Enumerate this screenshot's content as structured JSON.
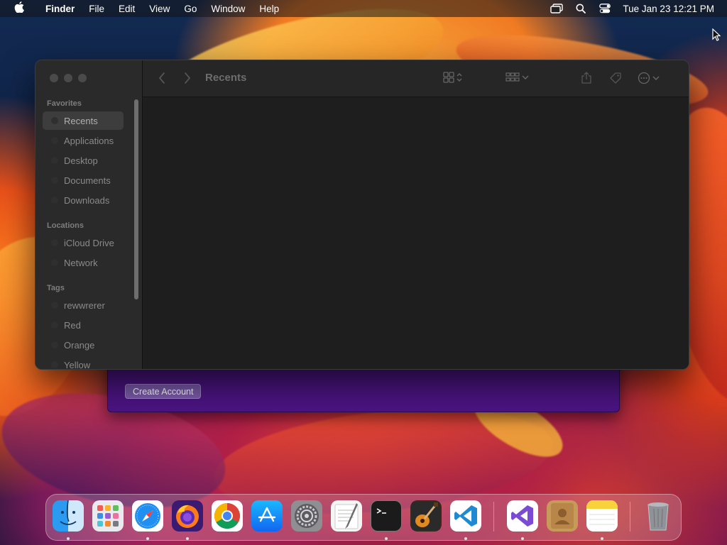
{
  "menubar": {
    "app_name": "Finder",
    "items": [
      "File",
      "Edit",
      "View",
      "Go",
      "Window",
      "Help"
    ],
    "clock": "Tue Jan 23  12:21 PM",
    "status_icons": [
      "screen-mirroring-icon",
      "spotlight-search-icon",
      "control-center-icon"
    ]
  },
  "finder": {
    "title": "Recents",
    "sidebar": {
      "favorites_header": "Favorites",
      "favorites": [
        "Recents",
        "Applications",
        "Desktop",
        "Documents",
        "Downloads"
      ],
      "locations_header": "Locations",
      "locations": [
        "iCloud Drive",
        "Network"
      ],
      "tags_header": "Tags",
      "tags": [
        "rewwrerer",
        "Red",
        "Orange",
        "Yellow"
      ]
    },
    "selected_item": "Recents"
  },
  "purple_window": {
    "button_label": "Create Account"
  },
  "dock": {
    "apps": [
      "Finder",
      "Launchpad",
      "Safari",
      "Firefox",
      "Chrome",
      "App Store",
      "System Settings",
      "TextEdit",
      "Terminal",
      "GarageBand",
      "Visual Studio Code",
      "Visual Studio",
      "Contacts",
      "Notes",
      "Trash"
    ]
  },
  "colors": {
    "purple_window": "#4b1482",
    "finder_bg": "#1e1e1e",
    "sidebar_bg": "#2a2a2a"
  }
}
